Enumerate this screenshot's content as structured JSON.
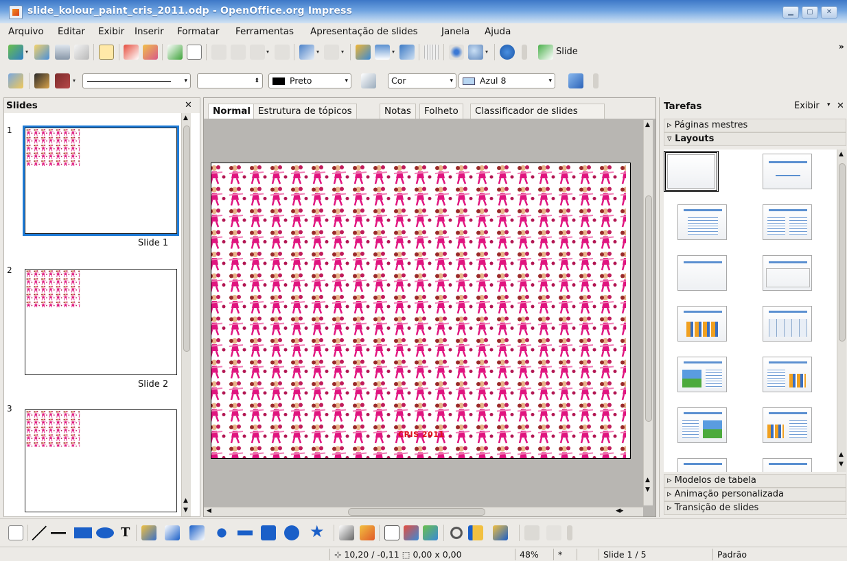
{
  "window": {
    "title": "slide_kolour_paint_cris_2011.odp - OpenOffice.org Impress"
  },
  "menu": [
    "Arquivo",
    "Editar",
    "Exibir",
    "Inserir",
    "Formatar",
    "Ferramentas",
    "Apresentação de slides",
    "Janela",
    "Ajuda"
  ],
  "toolbar": {
    "slide_button_label": "Slide",
    "overflow": "»"
  },
  "format_toolbar": {
    "line_color": "Preto",
    "fill_type": "Cor",
    "fill_color": "Azul 8"
  },
  "slides_pane": {
    "title": "Slides",
    "thumbnails": [
      {
        "number": "1",
        "label": "Slide 1"
      },
      {
        "number": "2",
        "label": "Slide 2"
      },
      {
        "number": "3",
        "label": ""
      }
    ]
  },
  "view_tabs": [
    "Normal",
    "Estrutura de tópicos",
    "Notas",
    "Folheto",
    "Classificador de slides"
  ],
  "slide": {
    "credit_text": "CRIS 2011"
  },
  "tasks": {
    "title": "Tarefas",
    "view_label": "Exibir",
    "sections": {
      "master_pages": "Páginas mestres",
      "layouts": "Layouts",
      "table_design": "Modelos de tabela",
      "custom_animation": "Animação personalizada",
      "slide_transition": "Transição de slides"
    }
  },
  "status": {
    "position": "10,20 / -0,11",
    "size": "0,00 x 0,00",
    "zoom": "48%",
    "modified": "*",
    "page": "Slide 1 / 5",
    "master": "Padrão"
  },
  "colors": {
    "selection": "#1d7ad6",
    "pattern_pink": "#e0157f",
    "credit_red": "#e0101a",
    "titlebar": "#3d78c7"
  }
}
